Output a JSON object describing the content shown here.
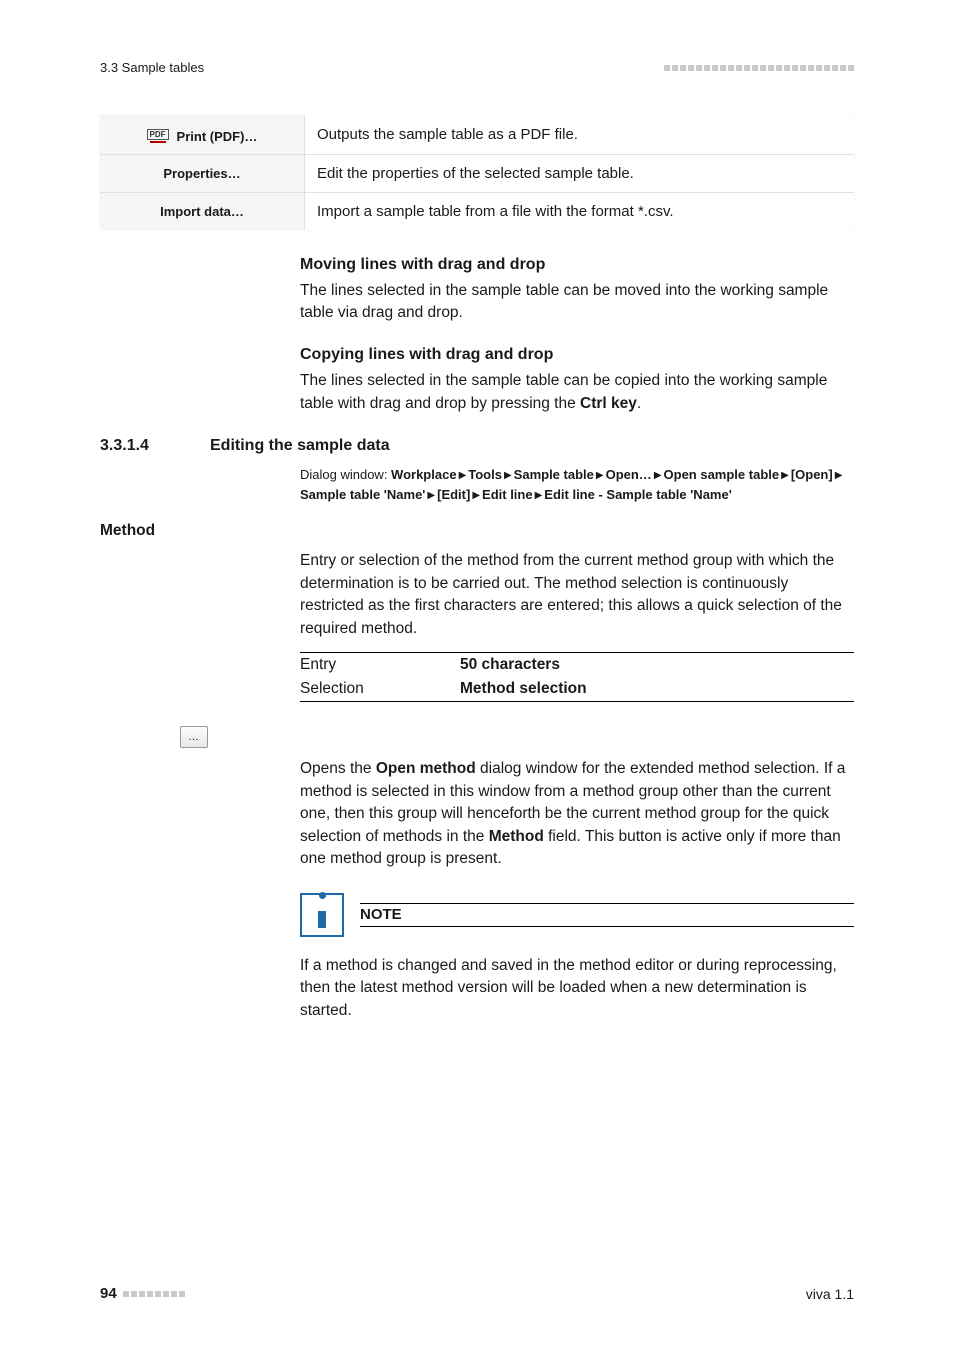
{
  "header": {
    "left": "3.3 Sample tables"
  },
  "action_table": [
    {
      "icon": "pdf",
      "label": "Print (PDF)…",
      "desc_pre": "Outputs the sample table as a PDF file.",
      "desc_bold": "",
      "desc_post": ""
    },
    {
      "icon": "",
      "label": "Properties…",
      "desc_pre": "Edit the properties of the selected sample table.",
      "desc_bold": "",
      "desc_post": ""
    },
    {
      "icon": "",
      "label": "Import data…",
      "desc_pre": "Import a sample table from a file with the format ",
      "desc_bold": "*.csv",
      "desc_post": "."
    }
  ],
  "move": {
    "title": "Moving lines with drag and drop",
    "body": "The lines selected in the sample table can be moved into the working sample table via drag and drop."
  },
  "copy": {
    "title": "Copying lines with drag and drop",
    "body_pre": "The lines selected in the sample table can be copied into the working sample table with drag and drop by pressing the ",
    "body_bold": "Ctrl key",
    "body_post": "."
  },
  "section": {
    "num": "3.3.1.4",
    "title": "Editing the sample data"
  },
  "dialog_path": {
    "lead": "Dialog window: ",
    "parts": [
      "Workplace",
      "Tools",
      "Sample table",
      "Open…",
      "Open sample table",
      "[Open]",
      "Sample table 'Name'",
      "[Edit]",
      "Edit line",
      "Edit line - Sample table 'Name'"
    ]
  },
  "method": {
    "heading": "Method",
    "body": "Entry or selection of the method from the current method group with which the determination is to be carried out. The method selection is continuously restricted as the first characters are entered; this allows a quick selection of the required method.",
    "rows": [
      {
        "label": "Entry",
        "value": "50 characters"
      },
      {
        "label": "Selection",
        "value": "Method selection"
      }
    ]
  },
  "browse": {
    "body_pre": "Opens the ",
    "body_bold1": "Open method",
    "body_mid": " dialog window for the extended method selection. If a method is selected in this window from a method group other than the current one, then this group will henceforth be the current method group for the quick selection of methods in the ",
    "body_bold2": "Method",
    "body_post": " field. This button is active only if more than one method group is present."
  },
  "note": {
    "title": "NOTE",
    "body": "If a method is changed and saved in the method editor or during reprocessing, then the latest method version will be loaded when a new determination is started."
  },
  "footer": {
    "page": "94",
    "right": "viva 1.1"
  }
}
